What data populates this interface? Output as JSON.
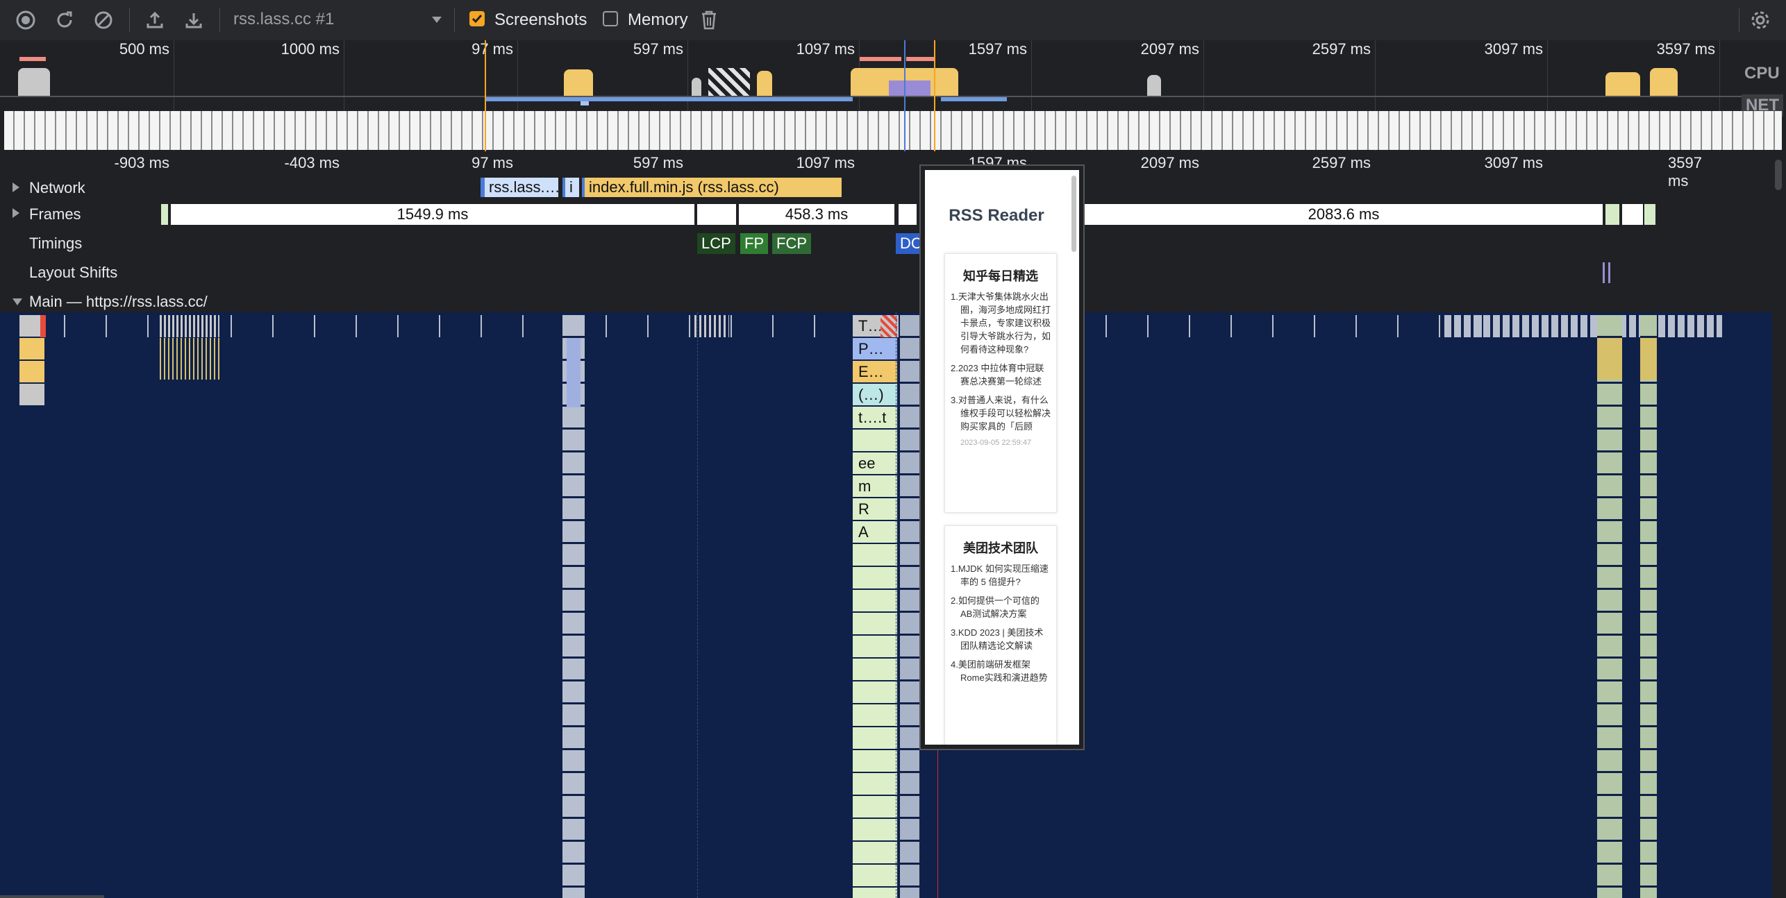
{
  "toolbar": {
    "record_icon": "record-icon",
    "reload_icon": "reload-icon",
    "clear_icon": "clear-icon",
    "upload_icon": "upload-icon",
    "download_icon": "download-icon",
    "profile_select": "rss.lass.cc #1",
    "screenshots_label": "Screenshots",
    "screenshots_checked": true,
    "memory_label": "Memory",
    "memory_checked": false,
    "trash_icon": "trash-icon",
    "settings_icon": "gear-icon",
    "accent_color": "#f5a623"
  },
  "overview": {
    "ticks": [
      "500 ms",
      "1000 ms",
      "97 ms",
      "597 ms",
      "1097 ms",
      "1597 ms",
      "2097 ms",
      "2597 ms",
      "3097 ms",
      "3597 ms"
    ],
    "cpu_label": "CPU",
    "net_label": "NET"
  },
  "ruler": {
    "ticks": [
      "-903 ms",
      "-403 ms",
      "97 ms",
      "597 ms",
      "1097 ms",
      "1597 ms",
      "2097 ms",
      "2597 ms",
      "3097 ms",
      "3597 ms"
    ]
  },
  "tracks": {
    "network": {
      "label": "Network",
      "requests": [
        "rss.lass.…",
        "i",
        "index.full.min.js (rss.lass.cc)"
      ]
    },
    "frames": {
      "label": "Frames",
      "durations": [
        "1549.9 ms",
        "458.3 ms",
        "2083.6 ms"
      ]
    },
    "timings": {
      "label": "Timings",
      "markers": [
        "LCP",
        "FP",
        "FCP",
        "DC"
      ]
    },
    "layout_shifts": {
      "label": "Layout Shifts"
    },
    "main": {
      "label": "Main — https://rss.lass.cc/",
      "slices": [
        "T…",
        "P…",
        "E…",
        "(…)",
        "t….t",
        "ee",
        "m",
        "R",
        "A"
      ]
    }
  },
  "screenshot_popup": {
    "app_title": "RSS Reader",
    "cards": [
      {
        "title": "知乎每日精选",
        "items": [
          "1.天津大爷集体跳水火出圈，海河多地成网红打卡景点，专家建议积极引导大爷跳水行为，如何看待这种现象?",
          "2.2023 中拉体育中冠联赛总决赛第一轮综述",
          "3.对普通人来说，有什么维权手段可以轻松解决购买家具的「后顾"
        ],
        "timestamp": "2023-09-05 22:59:47"
      },
      {
        "title": "美团技术团队",
        "items": [
          "1.MJDK 如何实现压缩速率的 5 倍提升?",
          "2.如何提供一个可信的AB测试解决方案",
          "3.KDD 2023 | 美团技术团队精选论文解读",
          "4.美团前端研发框架Rome实践和演进趋势"
        ]
      }
    ]
  }
}
